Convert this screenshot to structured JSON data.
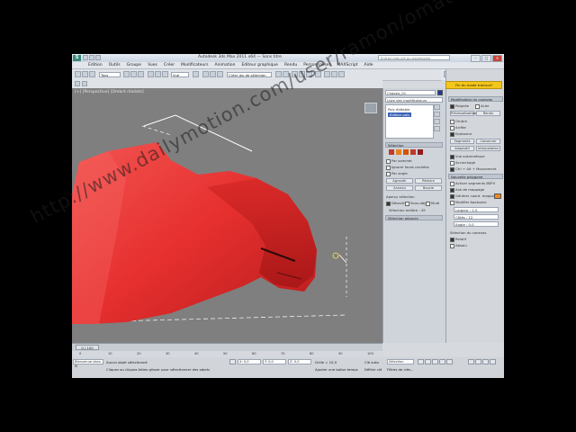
{
  "app": {
    "logo_text": "S",
    "title": "Autodesk 3ds Max 2011 x64 — Sans titre",
    "search_placeholder": "Entrez mot-clé ou expression"
  },
  "menu": [
    "Edition",
    "Outils",
    "Groupe",
    "Vues",
    "Créer",
    "Modificateurs",
    "Animation",
    "Editeur graphique",
    "Rendu",
    "Personnaliser",
    "MAXScript",
    "Aide"
  ],
  "toolbar": {
    "selection_filter": "Tous",
    "view_select": "Vue",
    "named_set": "Créer jeu de sélection"
  },
  "viewport": {
    "label": "[+] [Perspective] [Ombré réaliste]"
  },
  "right_panel": {
    "object_name": "Chassis_01",
    "dropdown": "Liste des modificateurs",
    "stack_items": [
      "Poly éditable",
      "Edition poly"
    ],
    "rollout_selection": "Sélection",
    "sel_rows": [
      "Par sommet",
      "Ignorer faces cachées",
      "Par angle",
      "Agrandir",
      "Réduire",
      "Anneau",
      "Boucle"
    ],
    "soft_selection": "Aperçu sélection",
    "soft_options": [
      "Désactiver",
      "Sous-objet",
      "Multi"
    ],
    "subobject_label": "Sélection entière : 45",
    "soft_sel_header": "Sélection adoucie"
  },
  "command_panel": {
    "yellow_button": "Fin du mode trainsurf",
    "header_1": "Modification du canevas",
    "options": [
      "Poignée",
      "Acier",
      "Prévisualisation",
      "Rendu",
      "Ombre",
      "Arrête",
      "Epaisseur",
      "Segments",
      "Conserver",
      "Adaptatif",
      "Interpolation",
      "Vue automatique",
      "Accrochage",
      "Ctrl + Alt + Mouvement"
    ],
    "header_2": "Nouvelle polygone",
    "checks": [
      "Activer segments BSPV",
      "Axe de mappage",
      "Générer coord. mappage",
      "Modifier épaisseur"
    ],
    "values": [
      "Largeur : 1.0",
      "Côtés : 12",
      "Angle : 0.0"
    ],
    "bottom_label": "Sélection du canevas",
    "bottom_items": [
      "Relatif",
      "Absolu"
    ]
  },
  "timeline": {
    "slider": "0 / 100"
  },
  "ruler_ticks": [
    "0",
    "10",
    "20",
    "30",
    "40",
    "50",
    "60",
    "70",
    "80",
    "90",
    "100"
  ],
  "status": {
    "script_label": "Bienvenue dans M",
    "selection": "Aucun objet sélectionné",
    "x": "X: 0,0",
    "y": "Y: 0,0",
    "z": "Z: 0,0",
    "grid": "Grille = 10,0",
    "auto_key": "Clé auto",
    "set_key": "Définir clé",
    "key_filter": "Sélection",
    "prompt": "Cliquez ou cliquez-faites glisser pour sélectionner des objets",
    "add_time": "Ajouter une balise temps",
    "filters": "Filtres de clés..."
  },
  "watermark": "http://www.dailymotion.com/user/ramon/omatt/1",
  "colors": {
    "car_red": "#e6302f",
    "viewport_bg": "#7f7f7f",
    "accent_yellow": "#f4c51a"
  }
}
